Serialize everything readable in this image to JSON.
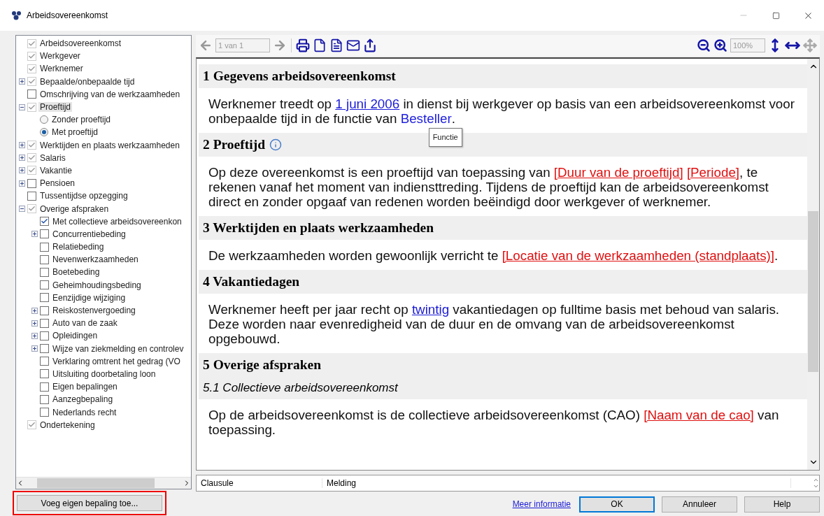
{
  "window": {
    "title": "Arbeidsovereenkomst"
  },
  "tree": [
    {
      "label": "Arbeidsovereenkomst",
      "kind": "checkbox",
      "checked": true,
      "disabled": true,
      "selected": false
    },
    {
      "label": "Werkgever",
      "kind": "checkbox",
      "checked": true,
      "disabled": true,
      "selected": false
    },
    {
      "label": "Werknemer",
      "kind": "checkbox",
      "checked": true,
      "disabled": true,
      "selected": false
    },
    {
      "label": "Bepaalde/onbepaalde tijd",
      "kind": "checkbox",
      "checked": true,
      "disabled": true,
      "selected": false,
      "expanded": false
    },
    {
      "label": "Omschrijving van de werkzaamheden",
      "kind": "checkbox",
      "checked": false,
      "disabled": false,
      "selected": false
    },
    {
      "label": "Proeftijd",
      "kind": "checkbox",
      "checked": true,
      "disabled": true,
      "selected": true,
      "expanded": true,
      "children": [
        {
          "label": "Zonder proeftijd",
          "kind": "radio",
          "checked": false,
          "disabled": false,
          "selected": false
        },
        {
          "label": "Met proeftijd",
          "kind": "radio",
          "checked": true,
          "disabled": false,
          "selected": false
        }
      ]
    },
    {
      "label": "Werktijden en plaats werkzaamheden",
      "kind": "checkbox",
      "checked": true,
      "disabled": true,
      "selected": false,
      "expanded": false
    },
    {
      "label": "Salaris",
      "kind": "checkbox",
      "checked": true,
      "disabled": true,
      "selected": false,
      "expanded": false
    },
    {
      "label": "Vakantie",
      "kind": "checkbox",
      "checked": true,
      "disabled": true,
      "selected": false,
      "expanded": false
    },
    {
      "label": "Pensioen",
      "kind": "checkbox",
      "checked": false,
      "disabled": false,
      "selected": false,
      "expanded": false
    },
    {
      "label": "Tussentijdse opzegging",
      "kind": "checkbox",
      "checked": false,
      "disabled": false,
      "selected": false
    },
    {
      "label": "Overige afspraken",
      "kind": "checkbox",
      "checked": true,
      "disabled": true,
      "selected": false,
      "expanded": true,
      "children": [
        {
          "label": "Met collectieve arbeidsovereenkon",
          "kind": "checkbox",
          "checked": true,
          "disabled": false,
          "selected": false
        },
        {
          "label": "Concurrentiebeding",
          "kind": "checkbox",
          "checked": false,
          "disabled": false,
          "selected": false,
          "expanded": false
        },
        {
          "label": "Relatiebeding",
          "kind": "checkbox",
          "checked": false,
          "disabled": false,
          "selected": false
        },
        {
          "label": "Nevenwerkzaamheden",
          "kind": "checkbox",
          "checked": false,
          "disabled": false,
          "selected": false
        },
        {
          "label": "Boetebeding",
          "kind": "checkbox",
          "checked": false,
          "disabled": false,
          "selected": false
        },
        {
          "label": "Geheimhoudingsbeding",
          "kind": "checkbox",
          "checked": false,
          "disabled": false,
          "selected": false
        },
        {
          "label": "Eenzijdige wijziging",
          "kind": "checkbox",
          "checked": false,
          "disabled": false,
          "selected": false
        },
        {
          "label": "Reiskostenvergoeding",
          "kind": "checkbox",
          "checked": false,
          "disabled": false,
          "selected": false,
          "expanded": false
        },
        {
          "label": "Auto van de zaak",
          "kind": "checkbox",
          "checked": false,
          "disabled": false,
          "selected": false,
          "expanded": false
        },
        {
          "label": "Opleidingen",
          "kind": "checkbox",
          "checked": false,
          "disabled": false,
          "selected": false,
          "expanded": false
        },
        {
          "label": "Wijze van ziekmelding en controlev",
          "kind": "checkbox",
          "checked": false,
          "disabled": false,
          "selected": false,
          "expanded": false
        },
        {
          "label": "Verklaring omtrent het gedrag (VO",
          "kind": "checkbox",
          "checked": false,
          "disabled": false,
          "selected": false
        },
        {
          "label": "Uitsluiting doorbetaling loon",
          "kind": "checkbox",
          "checked": false,
          "disabled": false,
          "selected": false
        },
        {
          "label": "Eigen bepalingen",
          "kind": "checkbox",
          "checked": false,
          "disabled": false,
          "selected": false
        },
        {
          "label": "Aanzegbepaling",
          "kind": "checkbox",
          "checked": false,
          "disabled": false,
          "selected": false
        },
        {
          "label": "Nederlands recht",
          "kind": "checkbox",
          "checked": false,
          "disabled": false,
          "selected": false
        }
      ]
    },
    {
      "label": "Ondertekening",
      "kind": "checkbox",
      "checked": true,
      "disabled": true,
      "selected": false
    }
  ],
  "add_button": "Voeg eigen bepaling toe...",
  "toolbar": {
    "page": "1 van 1",
    "zoom": "100%"
  },
  "document": [
    {
      "kind": "heading",
      "text": "1 Gegevens arbeidsovereenkomst"
    },
    {
      "kind": "paragraph",
      "segments": [
        {
          "kind": "plain",
          "text": "Werknemer treedt op "
        },
        {
          "kind": "link",
          "text": "1 juni 2006"
        },
        {
          "kind": "plain",
          "text": " in dienst bij werkgever op basis van een arbeidsovereenkomst voor onbepaalde tijd in de functie van "
        },
        {
          "kind": "value",
          "text": "Besteller",
          "tooltip": "Functie"
        },
        {
          "kind": "plain",
          "text": "."
        }
      ]
    },
    {
      "kind": "heading",
      "text": "2 Proeftijd",
      "info": true
    },
    {
      "kind": "paragraph",
      "segments": [
        {
          "kind": "plain",
          "text": "Op deze overeenkomst is een proeftijd van toepassing van "
        },
        {
          "kind": "placeholder",
          "text": "[Duur van de proeftijd]"
        },
        {
          "kind": "placeholder",
          "text": "[Periode]"
        },
        {
          "kind": "plain",
          "text": ", te rekenen vanaf het moment van indiensttreding. Tijdens de proeftijd kan de arbeidsovereenkomst direct en zonder opgaaf van redenen worden beëindigd door werkgever of werknemer."
        }
      ]
    },
    {
      "kind": "heading",
      "text": "3 Werktijden en plaats werkzaamheden"
    },
    {
      "kind": "paragraph",
      "segments": [
        {
          "kind": "plain",
          "text": "De werkzaamheden worden gewoonlijk verricht te "
        },
        {
          "kind": "placeholder",
          "text": "[Locatie van de werkzaamheden (standplaats)]"
        },
        {
          "kind": "plain",
          "text": "."
        }
      ]
    },
    {
      "kind": "heading",
      "text": "4 Vakantiedagen"
    },
    {
      "kind": "paragraph",
      "segments": [
        {
          "kind": "plain",
          "text": "Werknemer heeft per jaar recht op "
        },
        {
          "kind": "link",
          "text": "twintig"
        },
        {
          "kind": "plain",
          "text": " vakantiedagen op fulltime basis met behoud van salaris. Deze worden naar evenredigheid van de duur en de omvang van de arbeidsovereenkomst opgebouwd."
        }
      ]
    },
    {
      "kind": "heading",
      "text": "5 Overige afspraken"
    },
    {
      "kind": "subheading",
      "text": "5.1 Collectieve arbeidsovereenkomst"
    },
    {
      "kind": "paragraph",
      "segments": [
        {
          "kind": "plain",
          "text": "Op de arbeidsovereenkomst is de collectieve arbeidsovereenkomst (CAO) "
        },
        {
          "kind": "placeholder",
          "text": "[Naam van de cao]"
        },
        {
          "kind": "plain",
          "text": " van toepassing."
        }
      ]
    }
  ],
  "messages": {
    "columns": [
      "Clausule",
      "Melding"
    ]
  },
  "footer": {
    "link": "Meer informatie",
    "buttons": [
      {
        "label": "OK",
        "selected": true
      },
      {
        "label": "Annuleer",
        "selected": false
      },
      {
        "label": "Help",
        "selected": false
      }
    ]
  }
}
